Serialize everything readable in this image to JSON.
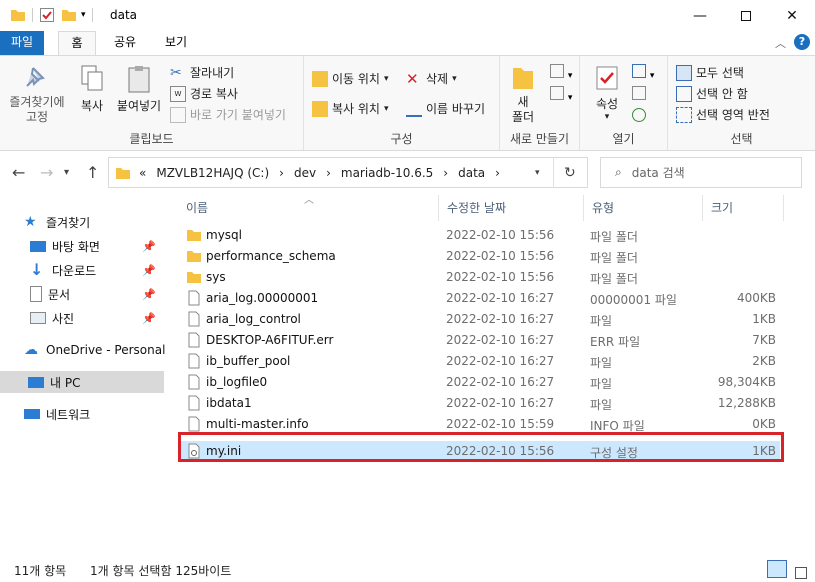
{
  "window": {
    "title": "data",
    "controls": [
      "minimize",
      "maximize",
      "close"
    ]
  },
  "tabs": [
    {
      "label": "파일"
    },
    {
      "label": "홈"
    },
    {
      "label": "공유"
    },
    {
      "label": "보기"
    }
  ],
  "ribbon": {
    "clipboard": {
      "label": "클립보드",
      "pin": "즐겨찾기에\n고정",
      "copy": "복사",
      "paste": "붙여넣기",
      "cut": "잘라내기",
      "copy_path": "경로 복사",
      "paste_shortcut": "바로 가기 붙여넣기"
    },
    "organize": {
      "label": "구성",
      "move_to": "이동 위치",
      "copy_to": "복사 위치",
      "delete": "삭제",
      "rename": "이름 바꾸기"
    },
    "new": {
      "label": "새로 만들기",
      "new_folder": "새\n폴더"
    },
    "open": {
      "label": "열기",
      "properties": "속성"
    },
    "select": {
      "label": "선택",
      "select_all": "모두 선택",
      "select_none": "선택 안 함",
      "invert": "선택 영역 반전"
    }
  },
  "address": {
    "prefix": "«",
    "crumbs": [
      "MZVLB12HAJQ (C:)",
      "dev",
      "mariadb-10.6.5",
      "data"
    ],
    "search_placeholder": "data 검색"
  },
  "nav": {
    "quick_access": "즐겨찾기",
    "items": [
      {
        "label": "바탕 화면",
        "icon": "desktop-icon"
      },
      {
        "label": "다운로드",
        "icon": "download-icon"
      },
      {
        "label": "문서",
        "icon": "document-icon"
      },
      {
        "label": "사진",
        "icon": "picture-icon"
      }
    ],
    "onedrive": "OneDrive - Personal",
    "this_pc": "내 PC",
    "network": "네트워크"
  },
  "columns": {
    "name": "이름",
    "date": "수정한 날짜",
    "type": "유형",
    "size": "크기"
  },
  "files": [
    {
      "name": "mysql",
      "date": "2022-02-10 15:56",
      "type": "파일 폴더",
      "size": "",
      "kind": "folder"
    },
    {
      "name": "performance_schema",
      "date": "2022-02-10 15:56",
      "type": "파일 폴더",
      "size": "",
      "kind": "folder"
    },
    {
      "name": "sys",
      "date": "2022-02-10 15:56",
      "type": "파일 폴더",
      "size": "",
      "kind": "folder"
    },
    {
      "name": "aria_log.00000001",
      "date": "2022-02-10 16:27",
      "type": "00000001 파일",
      "size": "400KB",
      "kind": "file"
    },
    {
      "name": "aria_log_control",
      "date": "2022-02-10 16:27",
      "type": "파일",
      "size": "1KB",
      "kind": "file"
    },
    {
      "name": "DESKTOP-A6FITUF.err",
      "date": "2022-02-10 16:27",
      "type": "ERR 파일",
      "size": "7KB",
      "kind": "file"
    },
    {
      "name": "ib_buffer_pool",
      "date": "2022-02-10 16:27",
      "type": "파일",
      "size": "2KB",
      "kind": "file"
    },
    {
      "name": "ib_logfile0",
      "date": "2022-02-10 16:27",
      "type": "파일",
      "size": "98,304KB",
      "kind": "file"
    },
    {
      "name": "ibdata1",
      "date": "2022-02-10 16:27",
      "type": "파일",
      "size": "12,288KB",
      "kind": "file"
    },
    {
      "name": "multi-master.info",
      "date": "2022-02-10 15:59",
      "type": "INFO 파일",
      "size": "0KB",
      "kind": "file"
    },
    {
      "name": "my.ini",
      "date": "2022-02-10 15:56",
      "type": "구성 설정",
      "size": "1KB",
      "kind": "config",
      "selected": true
    }
  ],
  "status": {
    "count": "11개 항목",
    "selection": "1개 항목 선택함 125바이트"
  },
  "colors": {
    "accent": "#1a6fbf",
    "selection": "#cce8ff",
    "highlight_border": "#d8232a",
    "folder": "#f5c242"
  }
}
